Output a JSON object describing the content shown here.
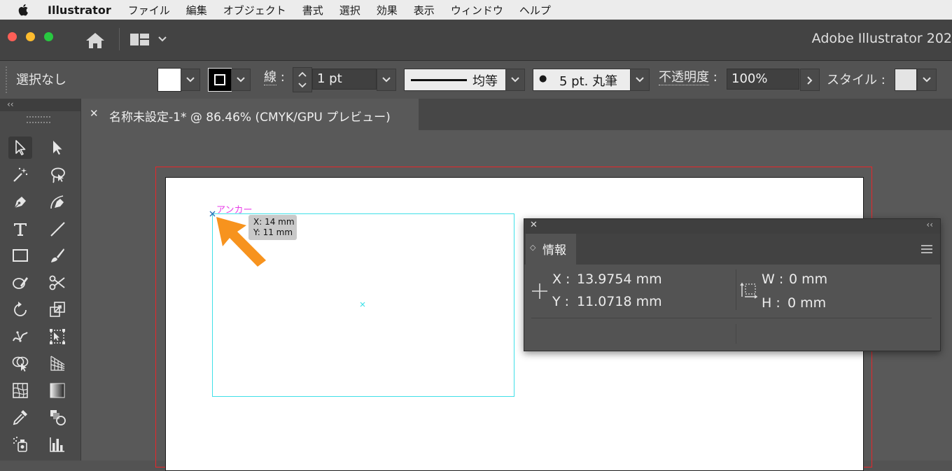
{
  "menubar": {
    "app_name": "Illustrator",
    "items": [
      "ファイル",
      "編集",
      "オブジェクト",
      "書式",
      "選択",
      "効果",
      "表示",
      "ウィンドウ",
      "ヘルプ"
    ]
  },
  "titlebar": {
    "app_title": "Adobe Illustrator 202"
  },
  "controlbar": {
    "selection_status": "選択なし",
    "stroke_label": "線",
    "stroke_colon": ":",
    "stroke_weight": "1 pt",
    "stroke_profile": "均等",
    "brush_definition": "5 pt. 丸筆",
    "brush_bullet": "●",
    "opacity_label": "不透明度",
    "opacity_colon": ":",
    "opacity_value": "100%",
    "style_label": "スタイル",
    "style_colon": ":"
  },
  "toolpanel": {
    "collapse_glyph": "‹‹"
  },
  "document_tab": {
    "close_glyph": "✕",
    "title": "名称未設定-1* @ 86.46% (CMYK/GPU プレビュー)"
  },
  "canvas": {
    "anchor_label": "アンカー",
    "tooltip_x": "X: 14 mm",
    "tooltip_y": "Y: 11 mm"
  },
  "info_panel": {
    "close_glyph": "✕",
    "collapse_glyph": "‹‹",
    "tab_label": "情報",
    "tab_arrows": "◇",
    "x_label": "X :",
    "x_value": "13.9754 mm",
    "y_label": "Y :",
    "y_value": "11.0718 mm",
    "w_label": "W :",
    "w_value": "0 mm",
    "h_label": "H :",
    "h_value": "0 mm"
  },
  "colors": {
    "artboard_bleed": "#e8262a",
    "selection_cyan": "#3fe0e8",
    "smart_guide_magenta": "#e83ee8",
    "annotation_arrow": "#f7931e"
  }
}
